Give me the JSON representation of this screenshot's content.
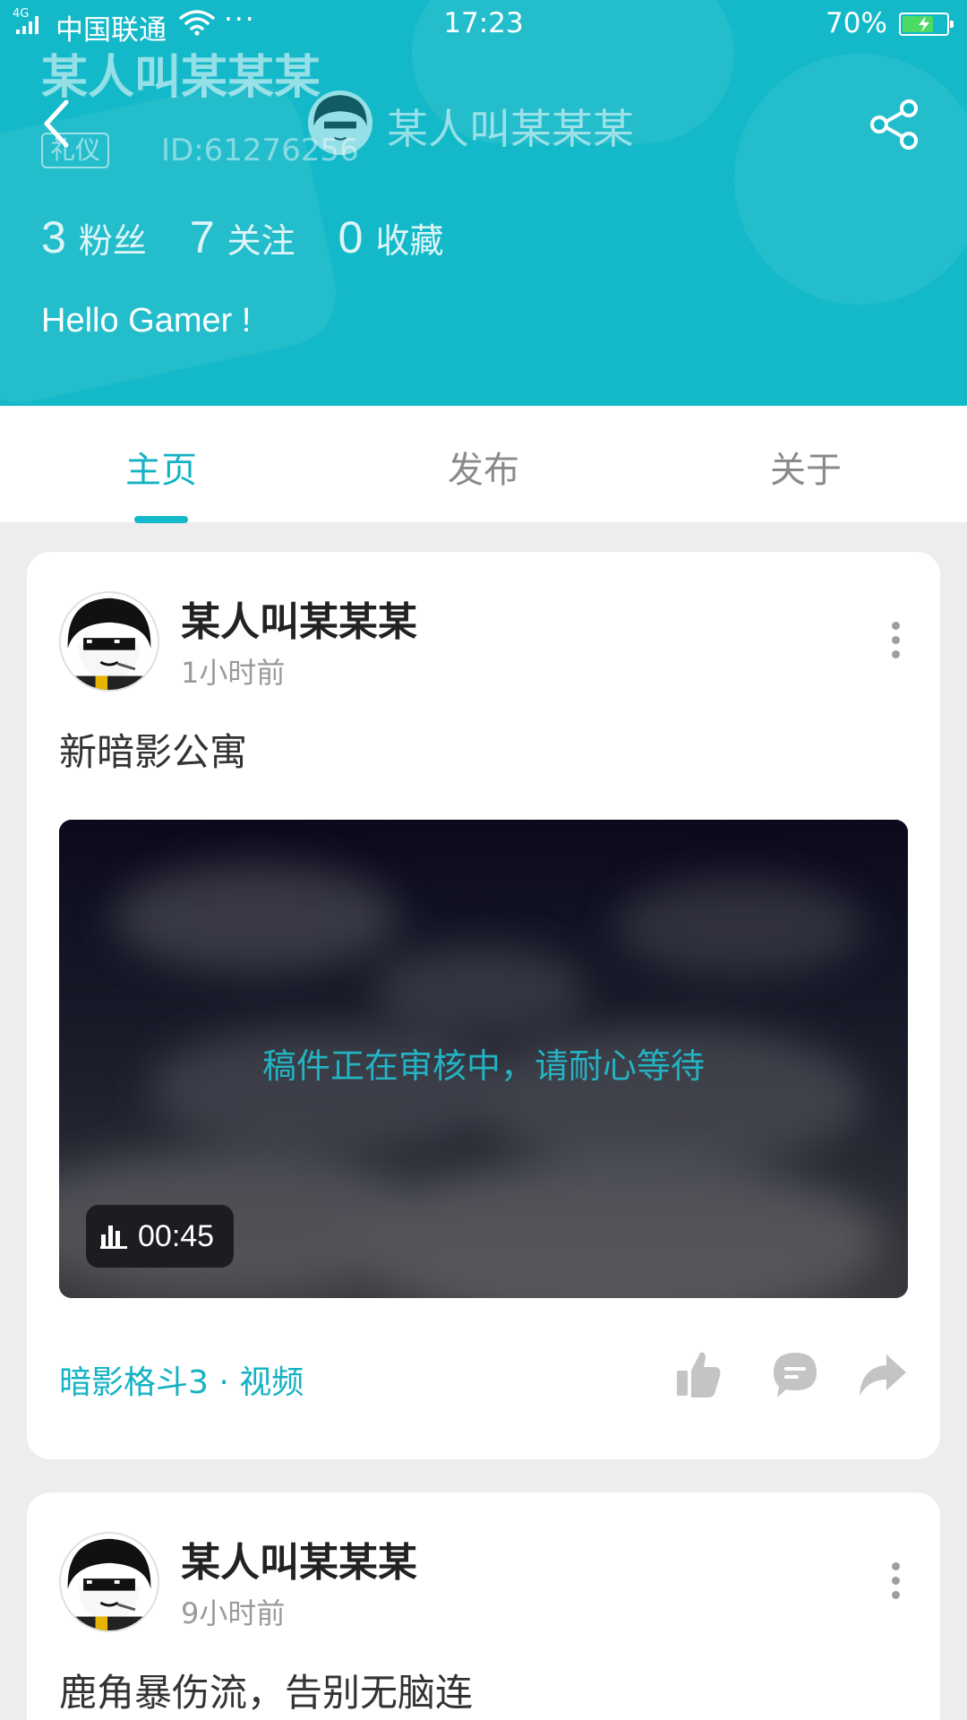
{
  "status_bar": {
    "network": "4G",
    "carrier": "中国联通",
    "more": "···",
    "time": "17:23",
    "battery_text": "70%",
    "battery_level": 0.7
  },
  "profile": {
    "name": "某人叫某某某",
    "role_badge": "礼仪",
    "id_text": "ID:61276256",
    "bio": "Hello Gamer !",
    "stats": [
      {
        "num": "3",
        "label": "粉丝"
      },
      {
        "num": "7",
        "label": "关注"
      },
      {
        "num": "0",
        "label": "收藏"
      }
    ]
  },
  "nav": {
    "title": "某人叫某某某"
  },
  "tabs": [
    {
      "label": "主页",
      "active": true
    },
    {
      "label": "发布",
      "active": false
    },
    {
      "label": "关于",
      "active": false
    }
  ],
  "posts": [
    {
      "author": "某人叫某某某",
      "time": "1小时前",
      "title": "新暗影公寓",
      "video": {
        "review_text": "稿件正在审核中，请耐心等待",
        "duration": "00:45"
      },
      "tag": "暗影格斗3 · 视频"
    },
    {
      "author": "某人叫某某某",
      "time": "9小时前",
      "title": "鹿角暴伤流，告别无脑连"
    }
  ],
  "colors": {
    "accent": "#14b9c9",
    "accent_text": "#14b2c3"
  },
  "icons": {
    "back": "chevron-left-icon",
    "share": "share-icon",
    "more": "more-vertical-icon",
    "like": "thumbs-up-icon",
    "comment": "comment-icon",
    "forward": "forward-icon",
    "duration": "bar-chart-icon"
  }
}
